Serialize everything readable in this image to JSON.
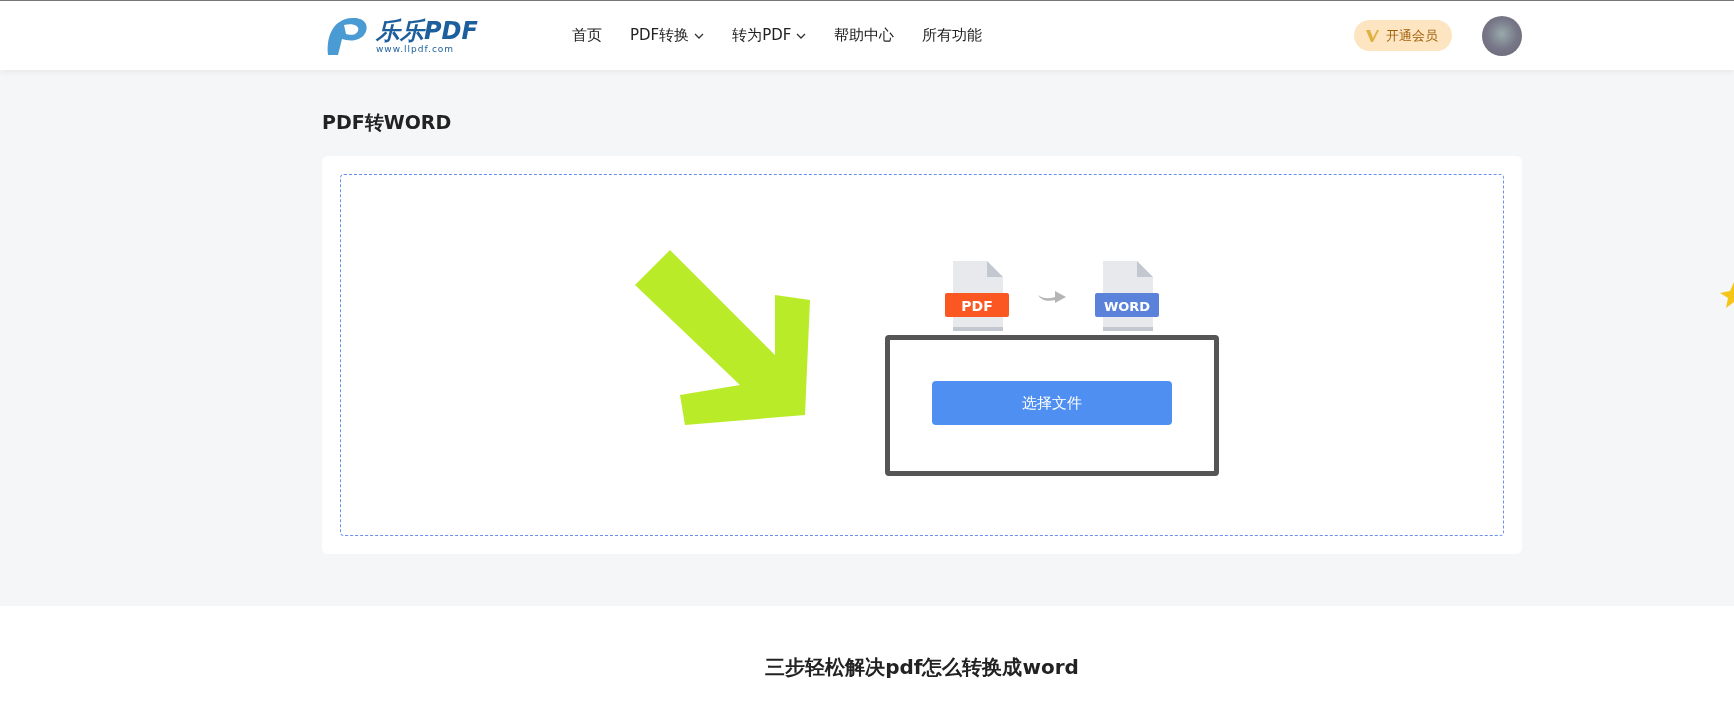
{
  "header": {
    "logo": {
      "wordmark": "乐乐PDF",
      "url": "www.llpdf.com"
    },
    "nav": [
      {
        "label": "首页",
        "has_menu": false
      },
      {
        "label": "PDF转换",
        "has_menu": true
      },
      {
        "label": "转为PDF",
        "has_menu": true
      },
      {
        "label": "帮助中心",
        "has_menu": false
      },
      {
        "label": "所有功能",
        "has_menu": false
      }
    ],
    "vip_button": "开通会员"
  },
  "page_title": "PDF转WORD",
  "converter": {
    "from_label": "PDF",
    "to_label": "WORD",
    "button": "选择文件"
  },
  "steps_heading": "三步轻松解决pdf怎么转换成word"
}
